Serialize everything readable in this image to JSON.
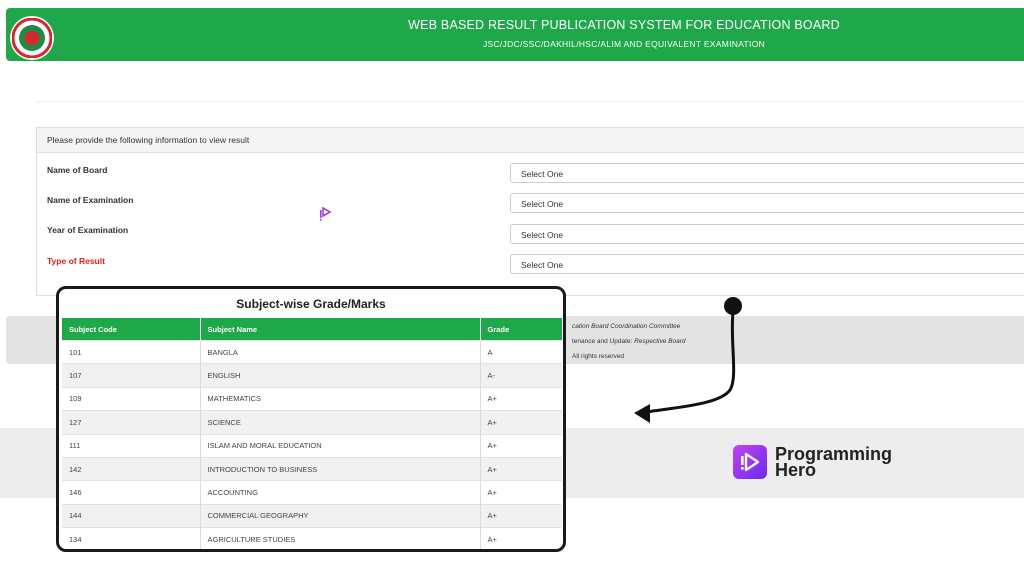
{
  "header": {
    "title": "WEB BASED RESULT PUBLICATION SYSTEM FOR EDUCATION BOARD",
    "subtitle": "JSC/JDC/SSC/DAKHIL/HSC/ALIM AND EQUIVALENT EXAMINATION",
    "emblem_icon": "government-seal-icon"
  },
  "form": {
    "heading": "Please provide the following information to view result",
    "fields": [
      {
        "label": "Name of Board",
        "value": "Select One"
      },
      {
        "label": "Name of Examination",
        "value": "Select One"
      },
      {
        "label": "Year of Examination",
        "value": "Select One"
      },
      {
        "label": "Type of Result",
        "value": "Select One"
      }
    ]
  },
  "footer": {
    "line1": "cation Board Coordination Committee",
    "line2_label": "tenance and Update:",
    "line2_value": "Respective Board",
    "line3": "All rights reserved"
  },
  "grades_card": {
    "title": "Subject-wise Grade/Marks",
    "columns": [
      "Subject Code",
      "Subject Name",
      "Grade"
    ],
    "rows": [
      [
        "101",
        "BANGLA",
        "A"
      ],
      [
        "107",
        "ENGLISH",
        "A-"
      ],
      [
        "109",
        "MATHEMATICS",
        "A+"
      ],
      [
        "127",
        "SCIENCE",
        "A+"
      ],
      [
        "111",
        "ISLAM AND MORAL EDUCATION",
        "A+"
      ],
      [
        "142",
        "INTRODUCTION TO BUSINESS",
        "A+"
      ],
      [
        "146",
        "ACCOUNTING",
        "A+"
      ],
      [
        "144",
        "COMMERCIAL GEOGRAPHY",
        "A+"
      ],
      [
        "134",
        "AGRICULTURE STUDIES",
        "A+"
      ]
    ]
  },
  "brand": {
    "name_line1": "Programming",
    "name_line2": "Hero",
    "icon": "programming-hero-logo-icon"
  },
  "colors": {
    "header_green": "#1fa84a",
    "required_red": "#e0201b",
    "brand_purple": "#8b3cf3"
  }
}
